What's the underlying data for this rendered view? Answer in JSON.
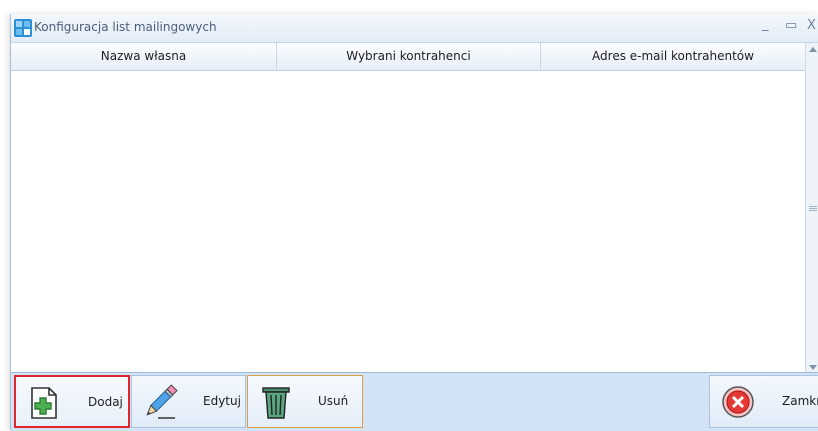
{
  "window": {
    "title": "Konfiguracja list mailingowych",
    "controls": {
      "minimize": "_",
      "maximize": "▭",
      "close": "X"
    }
  },
  "grid": {
    "columns": [
      "Nazwa własna",
      "Wybrani kontrahenci",
      "Adres e-mail kontrahentów"
    ],
    "rows": []
  },
  "toolbar": {
    "add_label": "Dodaj",
    "edit_label": "Edytuj",
    "delete_label": "Usuń",
    "close_label": "Zamknij"
  },
  "colors": {
    "highlight": "#e0262d",
    "toolbar_bg": "#d3e3f6",
    "add_icon": "#4caf50",
    "close_icon": "#e53935"
  }
}
